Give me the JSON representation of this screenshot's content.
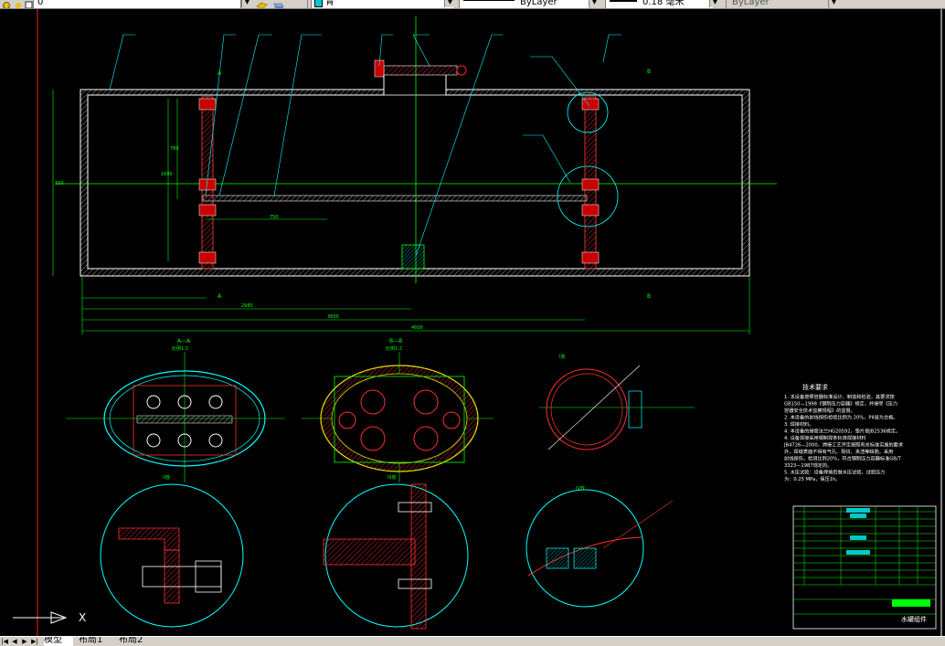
{
  "toolbar": {
    "layer_value": "0",
    "color_value": "青",
    "linetype_value": "ByLayer",
    "lineweight_value": "0.18 毫米",
    "plotstyle_value": "ByLayer",
    "color_accent": "#00c8c8"
  },
  "layout_tabs": [
    {
      "label": "模型",
      "active": true
    },
    {
      "label": "布局1",
      "active": false
    },
    {
      "label": "布局2",
      "active": false
    }
  ],
  "tab_nav": [
    "|◀",
    "◀",
    "▶",
    "▶|"
  ],
  "drawing": {
    "section_labels": {
      "a1": "A",
      "a2": "A",
      "b1": "B",
      "b2": "B"
    },
    "dims": {
      "d1": "330",
      "d2": "780",
      "d3": "1600",
      "d4": "750",
      "d5": "2980",
      "d6": "3600",
      "d7": "4600"
    },
    "views": {
      "aa_title": "A—A",
      "aa_scale": "比例1:2",
      "bb_title": "B—B",
      "bb_scale": "比例1:2",
      "detail_i_title": "I放",
      "detail_ii_title": "II放",
      "detail_iii_title": "III放",
      "detail_iv_title": "IV放"
    },
    "tech_title": "技术要求",
    "tech_lines": [
      "1. 本设备按照容器标准设计、制造和检验，其要求按",
      "GB150—1998《钢制压力容器》规定，并接受《压力",
      "容器安全技术监察规程》的监督。",
      "2. 本设备的射线探伤检验比例为 20%，PII级为合格。",
      "3. 焊接材料。",
      "4. 本设备的接管法兰HG20592，垫片按JB2536规定。",
      "4. 设备焊接采用钢制焊条标准焊接材料",
      "JB4726—2000，焊接工艺评定按照有关标准实施的要求",
      "外，焊缝表面不得有气孔、裂纹、夹渣等缺陷，采用",
      "射线探伤，检测比例20%，符合钢制压力容器标准GB/T",
      "3323—1987规定的。",
      "5. 水压试验：设备焊接后做水压试验，试验压力",
      "为：0.25 MPa，保压1h。"
    ],
    "title_block_name": "水罐组件"
  }
}
